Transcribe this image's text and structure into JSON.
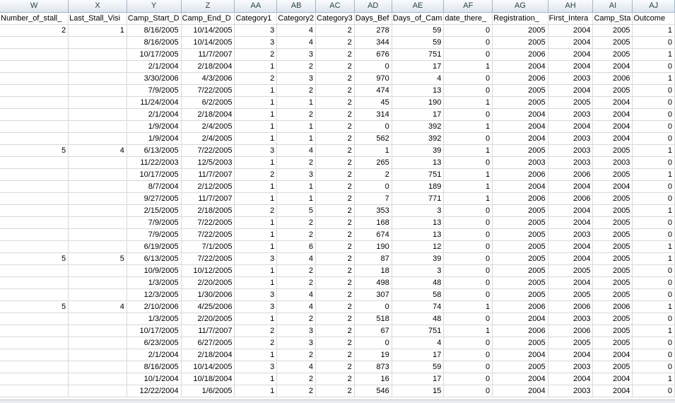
{
  "columns": [
    "W",
    "X",
    "Y",
    "Z",
    "AA",
    "AB",
    "AC",
    "AD",
    "AE",
    "AF",
    "AG",
    "AH",
    "AI",
    "AJ"
  ],
  "fields": [
    "Number_of_stall_",
    "Last_Stall_Visi",
    "Camp_Start_D",
    "Camp_End_D",
    "Category1",
    "Category2",
    "Category3",
    "Days_Bef",
    "Days_of_Cam",
    "date_there_",
    "Registration_",
    "First_Intera",
    "Camp_Sta",
    "Outcome"
  ],
  "rows": [
    [
      "2",
      "1",
      "8/16/2005",
      "10/14/2005",
      "3",
      "4",
      "2",
      "278",
      "59",
      "0",
      "2005",
      "2004",
      "2005",
      "1"
    ],
    [
      "",
      "",
      "8/16/2005",
      "10/14/2005",
      "3",
      "4",
      "2",
      "344",
      "59",
      "0",
      "2005",
      "2004",
      "2005",
      "0"
    ],
    [
      "",
      "",
      "10/17/2005",
      "11/7/2007",
      "2",
      "3",
      "2",
      "676",
      "751",
      "0",
      "2006",
      "2004",
      "2005",
      "1"
    ],
    [
      "",
      "",
      "2/1/2004",
      "2/18/2004",
      "1",
      "2",
      "2",
      "0",
      "17",
      "1",
      "2004",
      "2004",
      "2004",
      "0"
    ],
    [
      "",
      "",
      "3/30/2006",
      "4/3/2006",
      "2",
      "3",
      "2",
      "970",
      "4",
      "0",
      "2006",
      "2003",
      "2006",
      "1"
    ],
    [
      "",
      "",
      "7/9/2005",
      "7/22/2005",
      "1",
      "2",
      "2",
      "474",
      "13",
      "0",
      "2005",
      "2004",
      "2005",
      "0"
    ],
    [
      "",
      "",
      "11/24/2004",
      "6/2/2005",
      "1",
      "1",
      "2",
      "45",
      "190",
      "1",
      "2005",
      "2005",
      "2004",
      "0"
    ],
    [
      "",
      "",
      "2/1/2004",
      "2/18/2004",
      "1",
      "2",
      "2",
      "314",
      "17",
      "0",
      "2004",
      "2003",
      "2004",
      "0"
    ],
    [
      "",
      "",
      "1/9/2004",
      "2/4/2005",
      "1",
      "1",
      "2",
      "0",
      "392",
      "1",
      "2004",
      "2004",
      "2004",
      "0"
    ],
    [
      "",
      "",
      "1/9/2004",
      "2/4/2005",
      "1",
      "1",
      "2",
      "562",
      "392",
      "0",
      "2004",
      "2003",
      "2004",
      "0"
    ],
    [
      "5",
      "4",
      "6/13/2005",
      "7/22/2005",
      "3",
      "4",
      "2",
      "1",
      "39",
      "1",
      "2005",
      "2003",
      "2005",
      "1"
    ],
    [
      "",
      "",
      "11/22/2003",
      "12/5/2003",
      "1",
      "2",
      "2",
      "265",
      "13",
      "0",
      "2003",
      "2003",
      "2003",
      "0"
    ],
    [
      "",
      "",
      "10/17/2005",
      "11/7/2007",
      "2",
      "3",
      "2",
      "2",
      "751",
      "1",
      "2006",
      "2006",
      "2005",
      "1"
    ],
    [
      "",
      "",
      "8/7/2004",
      "2/12/2005",
      "1",
      "1",
      "2",
      "0",
      "189",
      "1",
      "2004",
      "2004",
      "2004",
      "0"
    ],
    [
      "",
      "",
      "9/27/2005",
      "11/7/2007",
      "1",
      "1",
      "2",
      "7",
      "771",
      "1",
      "2006",
      "2006",
      "2005",
      "0"
    ],
    [
      "",
      "",
      "2/15/2005",
      "2/18/2005",
      "2",
      "5",
      "2",
      "353",
      "3",
      "0",
      "2005",
      "2004",
      "2005",
      "1"
    ],
    [
      "",
      "",
      "7/9/2005",
      "7/22/2005",
      "1",
      "2",
      "2",
      "168",
      "13",
      "0",
      "2005",
      "2004",
      "2005",
      "0"
    ],
    [
      "",
      "",
      "7/9/2005",
      "7/22/2005",
      "1",
      "2",
      "2",
      "674",
      "13",
      "0",
      "2005",
      "2003",
      "2005",
      "0"
    ],
    [
      "",
      "",
      "6/19/2005",
      "7/1/2005",
      "1",
      "6",
      "2",
      "190",
      "12",
      "0",
      "2005",
      "2004",
      "2005",
      "1"
    ],
    [
      "5",
      "5",
      "6/13/2005",
      "7/22/2005",
      "3",
      "4",
      "2",
      "87",
      "39",
      "0",
      "2005",
      "2004",
      "2005",
      "1"
    ],
    [
      "",
      "",
      "10/9/2005",
      "10/12/2005",
      "1",
      "2",
      "2",
      "18",
      "3",
      "0",
      "2005",
      "2005",
      "2005",
      "0"
    ],
    [
      "",
      "",
      "1/3/2005",
      "2/20/2005",
      "1",
      "2",
      "2",
      "498",
      "48",
      "0",
      "2005",
      "2004",
      "2005",
      "0"
    ],
    [
      "",
      "",
      "12/3/2005",
      "1/30/2006",
      "3",
      "4",
      "2",
      "307",
      "58",
      "0",
      "2005",
      "2005",
      "2005",
      "0"
    ],
    [
      "5",
      "4",
      "2/10/2006",
      "4/25/2006",
      "3",
      "4",
      "2",
      "0",
      "74",
      "1",
      "2006",
      "2006",
      "2006",
      "1"
    ],
    [
      "",
      "",
      "1/3/2005",
      "2/20/2005",
      "1",
      "2",
      "2",
      "518",
      "48",
      "0",
      "2004",
      "2003",
      "2005",
      "0"
    ],
    [
      "",
      "",
      "10/17/2005",
      "11/7/2007",
      "2",
      "3",
      "2",
      "67",
      "751",
      "1",
      "2006",
      "2006",
      "2005",
      "1"
    ],
    [
      "",
      "",
      "6/23/2005",
      "6/27/2005",
      "2",
      "3",
      "2",
      "0",
      "4",
      "0",
      "2005",
      "2005",
      "2005",
      "0"
    ],
    [
      "",
      "",
      "2/1/2004",
      "2/18/2004",
      "1",
      "2",
      "2",
      "19",
      "17",
      "0",
      "2004",
      "2004",
      "2004",
      "0"
    ],
    [
      "",
      "",
      "8/16/2005",
      "10/14/2005",
      "3",
      "4",
      "2",
      "873",
      "59",
      "0",
      "2005",
      "2003",
      "2005",
      "0"
    ],
    [
      "",
      "",
      "10/1/2004",
      "10/18/2004",
      "1",
      "2",
      "2",
      "16",
      "17",
      "0",
      "2004",
      "2004",
      "2004",
      "1"
    ],
    [
      "",
      "",
      "12/22/2004",
      "1/6/2005",
      "1",
      "2",
      "2",
      "546",
      "15",
      "0",
      "2004",
      "2003",
      "2004",
      "0"
    ]
  ],
  "colors": {
    "header_bg_top": "#f9fbfd",
    "header_bg_bottom": "#dfe6ee",
    "gridline": "#d9d9d9",
    "header_border": "#9eb6ce"
  }
}
